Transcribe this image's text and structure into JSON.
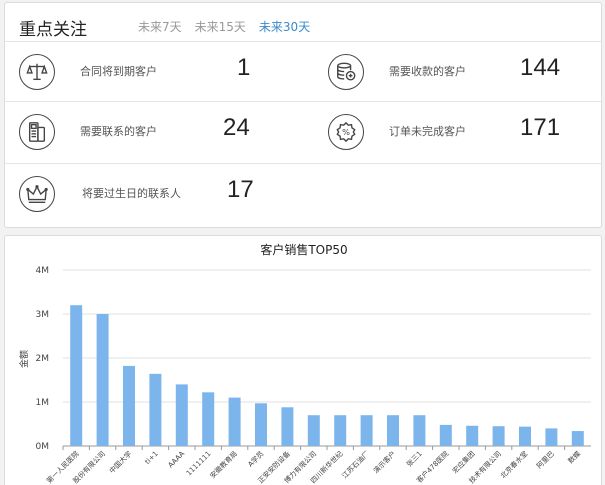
{
  "focus": {
    "title": "重点关注",
    "ranges": [
      "未来7天",
      "未来15天",
      "未来30天"
    ],
    "active_range": "未来30天",
    "stats": [
      {
        "label": "合同将到期客户",
        "value": "1",
        "icon": "scale-icon"
      },
      {
        "label": "需要收款的客户",
        "value": "144",
        "icon": "coins-icon"
      },
      {
        "label": "需要联系的客户",
        "value": "24",
        "icon": "phone-icon"
      },
      {
        "label": "订单未完成客户",
        "value": "171",
        "icon": "percent-badge-icon"
      },
      {
        "label": "将要过生日的联系人",
        "value": "17",
        "icon": "crown-icon"
      }
    ]
  },
  "chart_data": {
    "type": "bar",
    "title": "客户销售TOP50",
    "ylabel": "金额",
    "ylim": [
      0,
      4000000
    ],
    "ytick_labels": [
      "0M",
      "1M",
      "2M",
      "3M",
      "4M"
    ],
    "categories": [
      "第一人民医院",
      "股份有限公司",
      "中国大学",
      "ti+1",
      "AAAA",
      "1111111",
      "安徽教育局",
      "A学员",
      "正安安防设备",
      "博力有限公司",
      "四川新华世纪",
      "江苏石油厂",
      "演示客户",
      "张三1",
      "客户478医院",
      "宏应集团",
      "技术有限公司",
      "北京春水堂",
      "阿里巴",
      "数蝶"
    ],
    "values": [
      3200000,
      3000000,
      1820000,
      1640000,
      1400000,
      1220000,
      1100000,
      970000,
      880000,
      700000,
      700000,
      700000,
      700000,
      700000,
      480000,
      460000,
      450000,
      440000,
      400000,
      340000
    ],
    "color": "#7cb5ec",
    "grid": true
  }
}
